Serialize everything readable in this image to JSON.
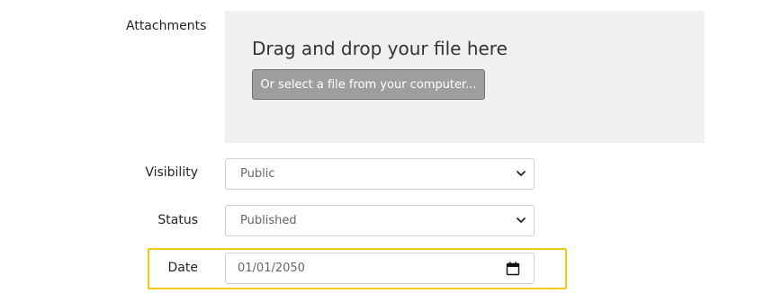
{
  "attachments": {
    "label": "Attachments",
    "dropzone_text": "Drag and drop your file here",
    "select_button_label": "Or select a file from your computer..."
  },
  "visibility": {
    "label": "Visibility",
    "value": "Public",
    "icon": "chevron-down-icon"
  },
  "status": {
    "label": "Status",
    "value": "Published",
    "icon": "chevron-down-icon"
  },
  "date": {
    "label": "Date",
    "value": "01/01/2050",
    "icon": "calendar-icon",
    "highlight_color": "#f5c518"
  }
}
